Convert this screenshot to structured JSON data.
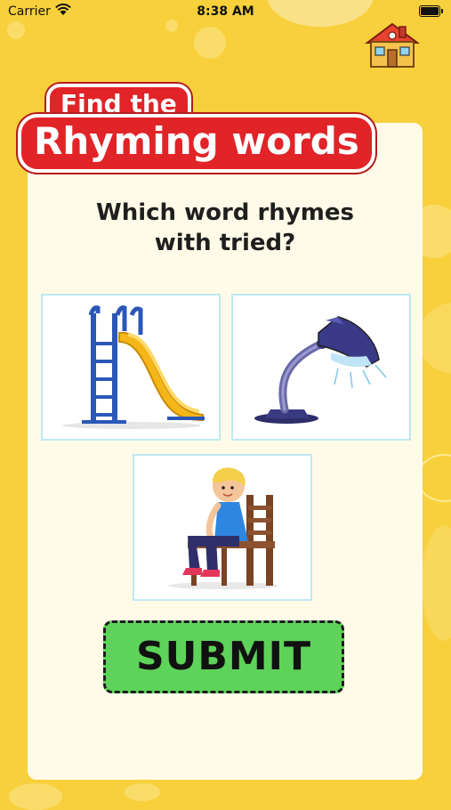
{
  "status_bar": {
    "carrier": "Carrier",
    "time": "8:38 AM"
  },
  "header": {
    "home_icon": "house-icon"
  },
  "title": {
    "line1": "Find the",
    "line2": "Rhyming words"
  },
  "question": {
    "line1": "Which word rhymes",
    "line2": "with tried?"
  },
  "options": [
    {
      "id": "slide",
      "icon": "playground-slide-image"
    },
    {
      "id": "lamp",
      "icon": "desk-lamp-image"
    },
    {
      "id": "sit",
      "icon": "boy-sitting-chair-image"
    }
  ],
  "submit": {
    "label": "SUBMIT"
  },
  "colors": {
    "background": "#f7d03c",
    "card": "#fffbe8",
    "title": "#e02428",
    "submit": "#5ed35a",
    "option_border": "#bfe9f2"
  }
}
